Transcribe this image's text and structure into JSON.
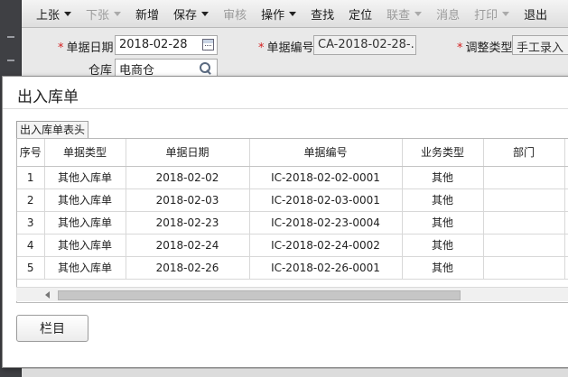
{
  "toolbar": {
    "items": [
      {
        "label": "上张",
        "dropdown": true,
        "disabled": false
      },
      {
        "label": "下张",
        "dropdown": true,
        "disabled": true
      },
      {
        "label": "新增",
        "dropdown": false,
        "disabled": false
      },
      {
        "label": "保存",
        "dropdown": true,
        "disabled": false
      },
      {
        "label": "审核",
        "dropdown": false,
        "disabled": true
      },
      {
        "label": "操作",
        "dropdown": true,
        "disabled": false
      },
      {
        "label": "查找",
        "dropdown": false,
        "disabled": false
      },
      {
        "label": "定位",
        "dropdown": false,
        "disabled": false
      },
      {
        "label": "联查",
        "dropdown": true,
        "disabled": true
      },
      {
        "label": "消息",
        "dropdown": false,
        "disabled": true
      },
      {
        "label": "打印",
        "dropdown": true,
        "disabled": true
      },
      {
        "label": "退出",
        "dropdown": false,
        "disabled": false
      }
    ]
  },
  "form": {
    "doc_date_label": "单据日期",
    "doc_date_value": "2018-02-28",
    "doc_no_label": "单据编号",
    "doc_no_value": "CA-2018-02-28-...",
    "adjust_type_label": "调整类型",
    "adjust_type_value": "手工录入",
    "warehouse_label": "仓库",
    "warehouse_value": "电商仓"
  },
  "dialog": {
    "title": "出入库单",
    "tab_label": "出入库单表头",
    "columns": [
      "序号",
      "单据类型",
      "单据日期",
      "单据编号",
      "业务类型",
      "部门"
    ],
    "rows": [
      [
        "1",
        "其他入库单",
        "2018-02-02",
        "IC-2018-02-02-0001",
        "其他",
        ""
      ],
      [
        "2",
        "其他入库单",
        "2018-02-03",
        "IC-2018-02-03-0001",
        "其他",
        ""
      ],
      [
        "3",
        "其他入库单",
        "2018-02-23",
        "IC-2018-02-23-0004",
        "其他",
        ""
      ],
      [
        "4",
        "其他入库单",
        "2018-02-24",
        "IC-2018-02-24-0002",
        "其他",
        ""
      ],
      [
        "5",
        "其他入库单",
        "2018-02-26",
        "IC-2018-02-26-0001",
        "其他",
        ""
      ]
    ],
    "columns_button_label": "栏目"
  },
  "colors": {
    "required_marker": "#d42020",
    "disabled_text": "#9b9b9b"
  }
}
